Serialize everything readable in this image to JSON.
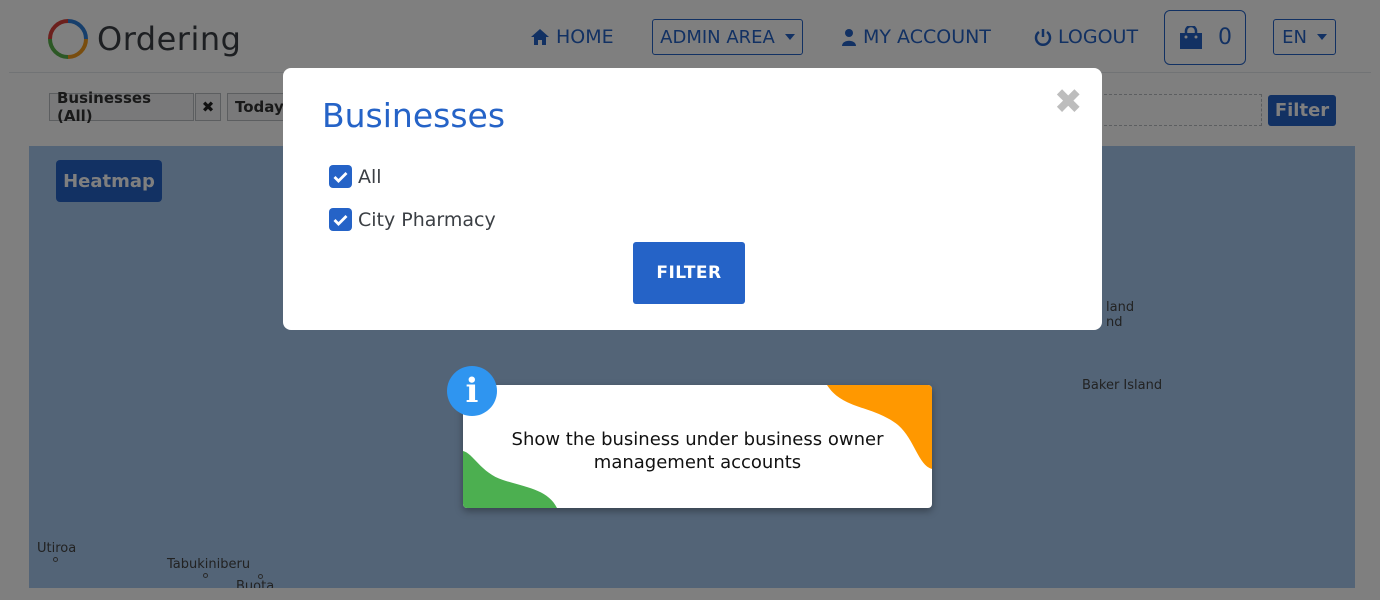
{
  "app": {
    "name": "Ordering"
  },
  "nav": {
    "home": "HOME",
    "admin": "ADMIN AREA",
    "account": "MY ACCOUNT",
    "logout": "LOGOUT",
    "cart_count": "0",
    "language": "EN"
  },
  "filters": {
    "business_tag": "Businesses (All)",
    "remove_icon": "✖",
    "date_tag": "Today",
    "filter_button": "Filter"
  },
  "map": {
    "heatmap_button": "Heatmap",
    "labels": {
      "island_1": "land",
      "island_2": "nd",
      "baker": "Baker Island",
      "utiroa": "Utiroa",
      "tabukiniberu": "Tabukiniberu",
      "buota": "Buota"
    }
  },
  "modal": {
    "title": "Businesses",
    "close_icon": "✖",
    "options": [
      {
        "label": "All",
        "checked": true
      },
      {
        "label": "City Pharmacy",
        "checked": true
      }
    ],
    "filter_button": "FILTER"
  },
  "tooltip": {
    "icon": "i",
    "text": "Show the business under business owner management accounts"
  },
  "colors": {
    "brand": "#2563c7",
    "map_water": "#a6c8ee",
    "tip_green": "#4caf50",
    "tip_orange": "#ff9800",
    "info_blue": "#2f95f0"
  }
}
